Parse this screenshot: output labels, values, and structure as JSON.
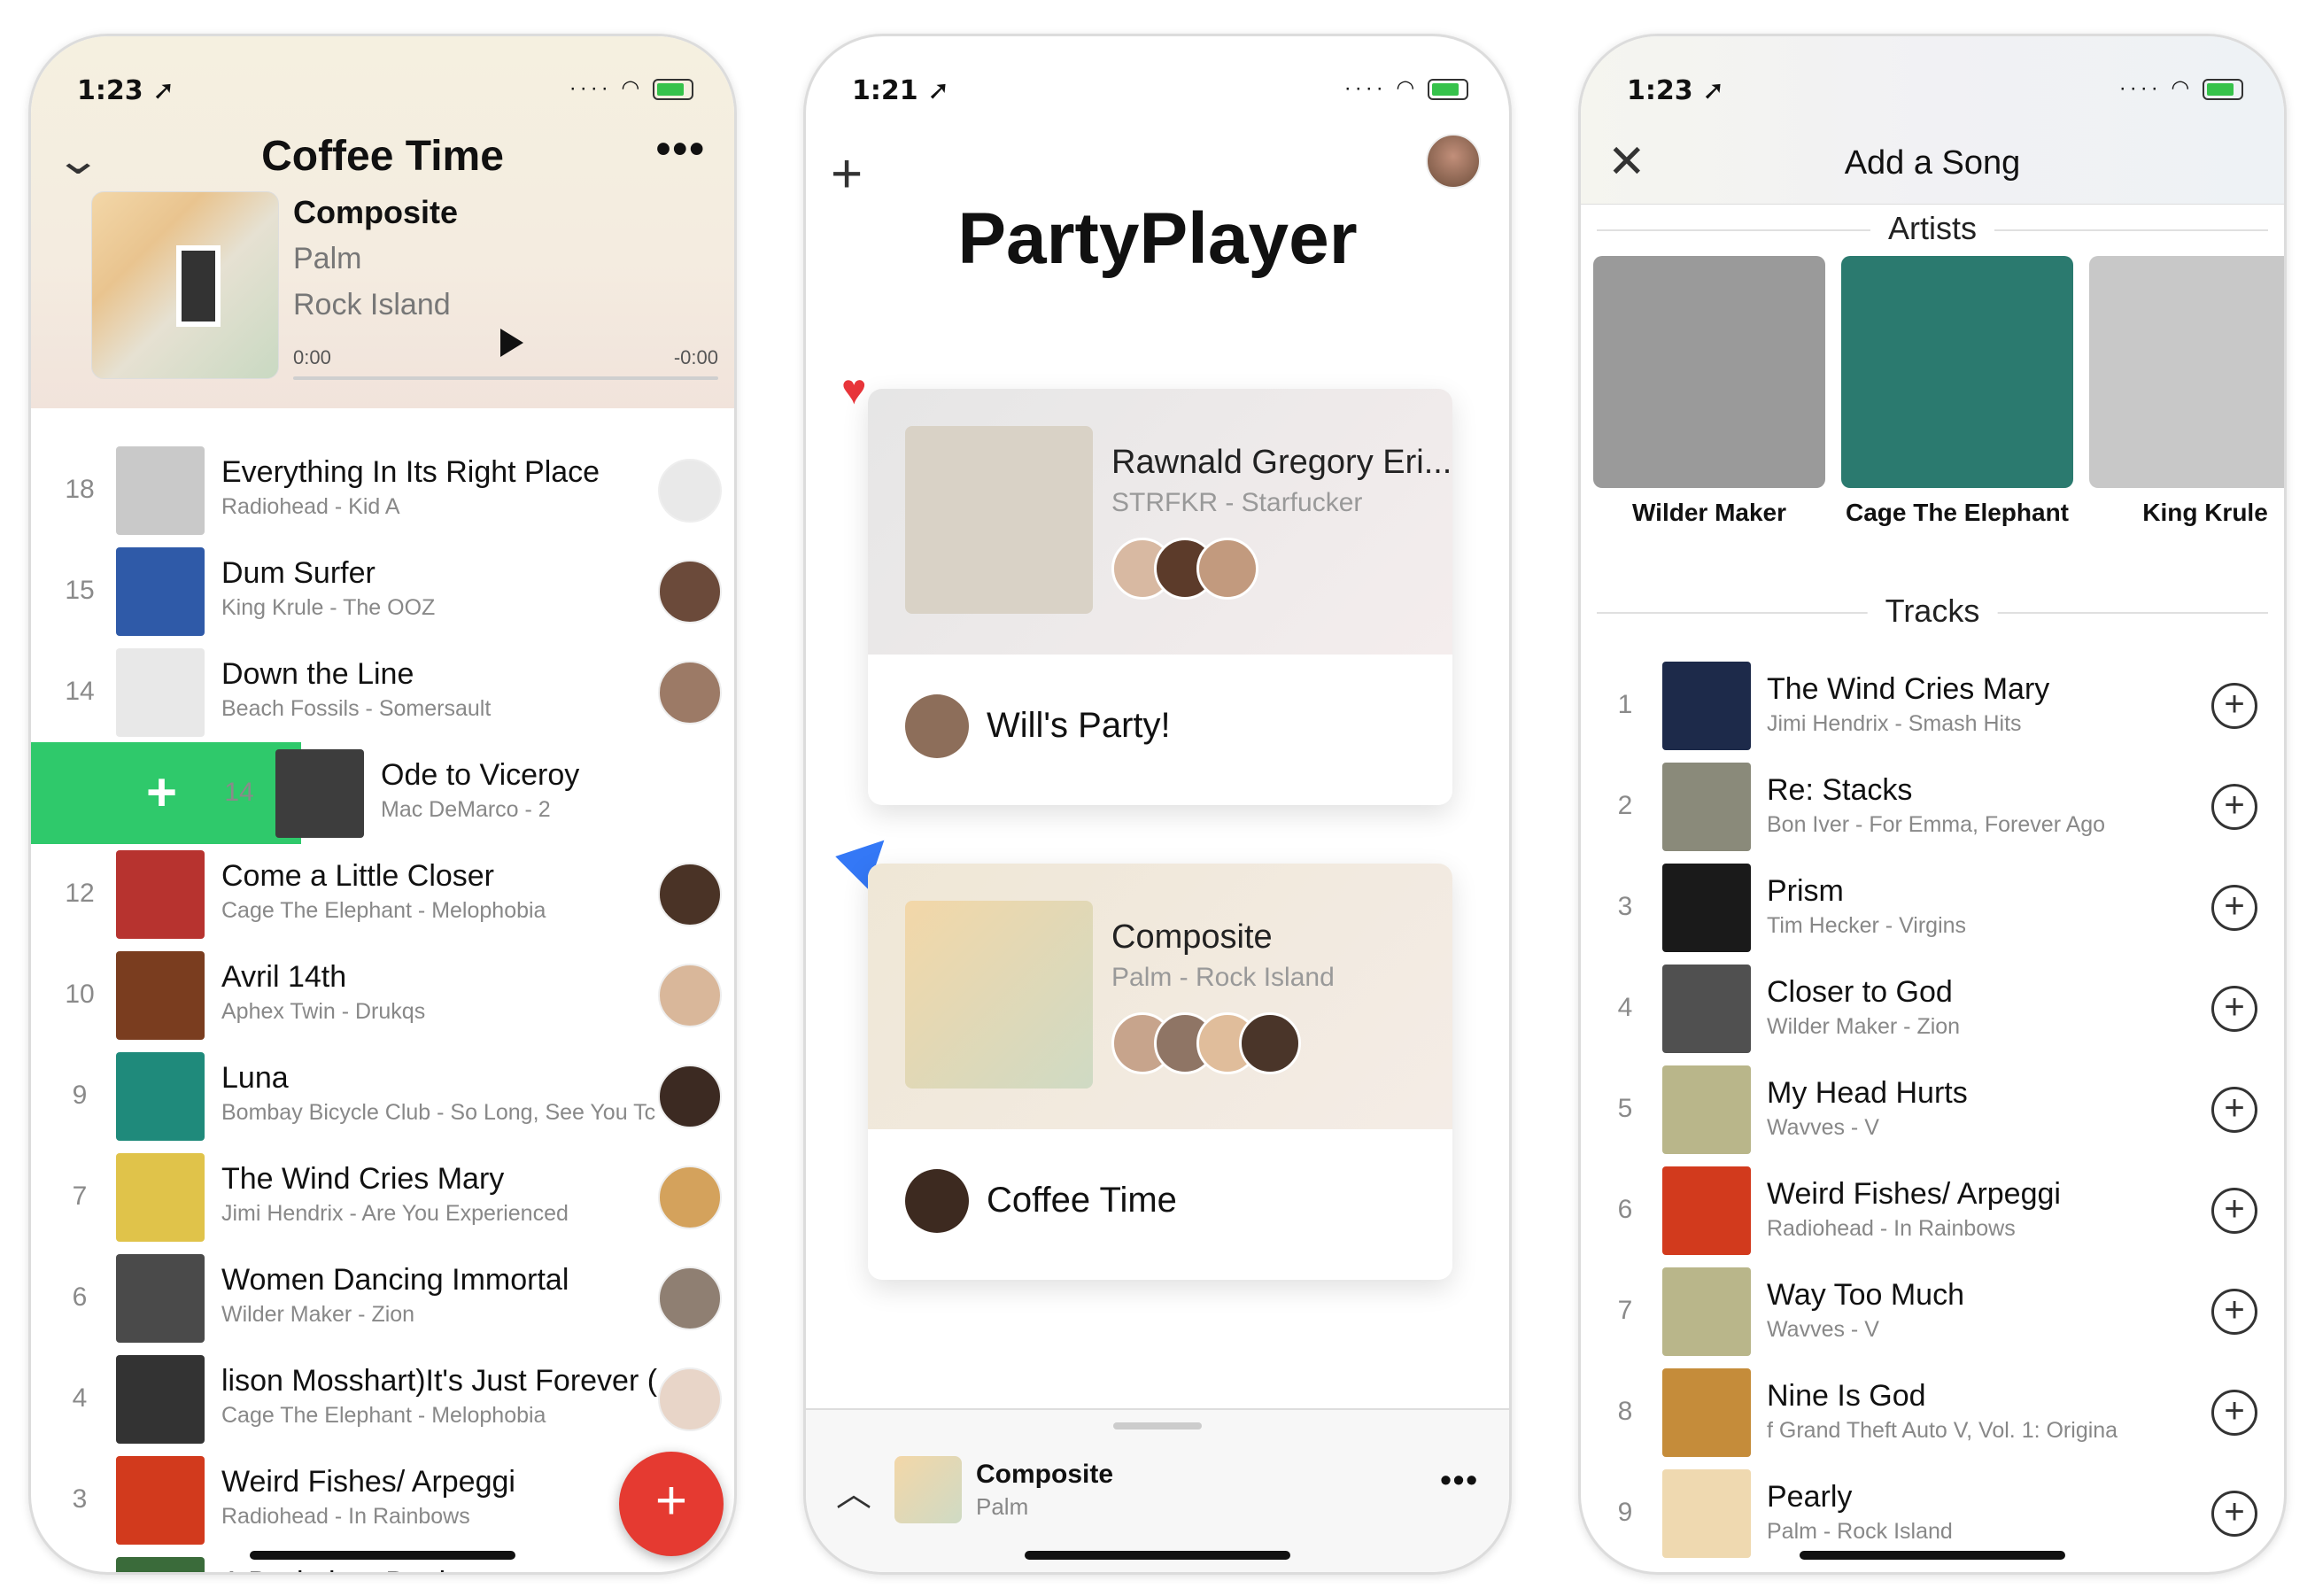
{
  "status": {
    "phone1_time": "1:23 ➚",
    "phone2_time": "1:21 ➚",
    "phone3_time": "1:23 ➚"
  },
  "coffee": {
    "title": "Coffee Time",
    "now_playing": {
      "song": "Composite",
      "artist": "Palm",
      "album": "Rock Island",
      "elapsed": "0:00",
      "remaining": "-0:00"
    },
    "queue": [
      {
        "votes": "18",
        "title": "Everything In Its Right Place",
        "sub": "Radiohead - Kid A",
        "art": "#c9c9c9"
      },
      {
        "votes": "15",
        "title": "Dum Surfer",
        "sub": "King Krule - The OOZ",
        "art": "#2f5aa8"
      },
      {
        "votes": "14",
        "title": "Down the Line",
        "sub": "Beach Fossils - Somersault",
        "art": "#e8e8e8"
      },
      {
        "votes": "14",
        "title": "Ode to Viceroy",
        "sub": "Mac DeMarco - 2",
        "art": "#3d3d3d"
      },
      {
        "votes": "12",
        "title": "Come a Little Closer",
        "sub": "Cage The Elephant - Melophobia",
        "art": "#b7332f"
      },
      {
        "votes": "10",
        "title": "Avril 14th",
        "sub": "Aphex Twin - Drukqs",
        "art": "#7a3d1f"
      },
      {
        "votes": "9",
        "title": "Luna",
        "sub": "Bombay Bicycle Club - So Long, See You Tc",
        "art": "#1f8a7b"
      },
      {
        "votes": "7",
        "title": "The Wind Cries Mary",
        "sub": "Jimi Hendrix - Are You Experienced",
        "art": "#e0c34a"
      },
      {
        "votes": "6",
        "title": "Women Dancing Immortal",
        "sub": "Wilder Maker - Zion",
        "art": "#4a4a4a"
      },
      {
        "votes": "4",
        "title": "lison Mosshart)It's Just Forever (",
        "sub": "Cage The Elephant - Melophobia",
        "art": "#333333"
      },
      {
        "votes": "3",
        "title": "Weird Fishes/ Arpeggi",
        "sub": "Radiohead - In Rainbows",
        "art": "#d23a1d"
      },
      {
        "votes": "",
        "title": "A Drain in a Bottle",
        "sub": "",
        "art": "#3a6b3a"
      }
    ]
  },
  "party": {
    "title": "PartyPlayer",
    "cards": [
      {
        "song": "Rawnald Gregory Eri...",
        "sub": "STRFKR - Starfucker",
        "name": "Will's Party!",
        "art": "#d9d2c6"
      },
      {
        "song": "Composite",
        "sub": "Palm - Rock Island",
        "name": "Coffee Time",
        "art": "#efd9b0"
      }
    ],
    "mini": {
      "song": "Composite",
      "artist": "Palm"
    }
  },
  "add_song": {
    "title": "Add a Song",
    "artists_label": "Artists",
    "tracks_label": "Tracks",
    "artists": [
      {
        "name": "Wilder Maker",
        "art": "#9a9a9a"
      },
      {
        "name": "Cage The Elephant",
        "art": "#2b7a6f"
      },
      {
        "name": "King Krule",
        "art": "#c8c8c8"
      }
    ],
    "tracks": [
      {
        "n": "1",
        "title": "The Wind Cries Mary",
        "sub": "Jimi Hendrix - Smash Hits",
        "art": "#1d2a4a"
      },
      {
        "n": "2",
        "title": "Re: Stacks",
        "sub": "Bon Iver - For Emma, Forever Ago",
        "art": "#8a8a7a"
      },
      {
        "n": "3",
        "title": "Prism",
        "sub": "Tim Hecker - Virgins",
        "art": "#1a1a1a"
      },
      {
        "n": "4",
        "title": "Closer to God",
        "sub": "Wilder Maker - Zion",
        "art": "#505050"
      },
      {
        "n": "5",
        "title": "My Head Hurts",
        "sub": "Wavves - V",
        "art": "#b9b68a"
      },
      {
        "n": "6",
        "title": "Weird Fishes/ Arpeggi",
        "sub": "Radiohead - In Rainbows",
        "art": "#d23a1d"
      },
      {
        "n": "7",
        "title": "Way Too Much",
        "sub": "Wavves - V",
        "art": "#b9b68a"
      },
      {
        "n": "8",
        "title": "Nine Is God",
        "sub": "f Grand Theft Auto V, Vol. 1: Origina",
        "art": "#c58c3a"
      },
      {
        "n": "9",
        "title": "Pearly",
        "sub": "Palm - Rock Island",
        "art": "#efd9b0"
      }
    ]
  }
}
